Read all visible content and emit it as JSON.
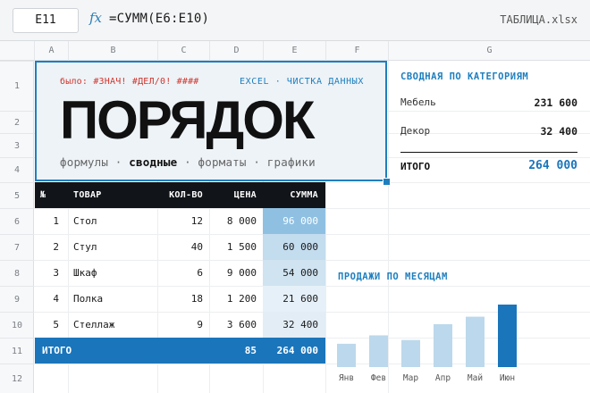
{
  "formula_bar": {
    "cell_ref": "E11",
    "fx_label": "fx",
    "formula": "=СУММ(E6:E10)",
    "file_name": "ТАБЛИЦА.xlsx"
  },
  "columns": [
    "A",
    "B",
    "C",
    "D",
    "E",
    "F",
    "G"
  ],
  "rows": [
    "1",
    "2",
    "3",
    "4",
    "5",
    "6",
    "7",
    "8",
    "9",
    "10",
    "11",
    "12"
  ],
  "hero": {
    "errors": "было: #ЗНАЧ! #ДЕЛ/0! ####",
    "tagline": "EXCEL · ЧИСТКА ДАННЫХ",
    "title": "ПОРЯДОК",
    "sub_1": "формулы · ",
    "sub_bold": "сводные",
    "sub_2": " · форматы · графики"
  },
  "table": {
    "headers": [
      "№",
      "ТОВАР",
      "КОЛ-ВО",
      "ЦЕНА",
      "СУММА"
    ],
    "rows": [
      {
        "n": "1",
        "item": "Стол",
        "qty": "12",
        "price": "8 000",
        "sum": "96 000",
        "shade": 0.9
      },
      {
        "n": "2",
        "item": "Стул",
        "qty": "40",
        "price": "1 500",
        "sum": "60 000",
        "shade": 0.55
      },
      {
        "n": "3",
        "item": "Шкаф",
        "qty": "6",
        "price": "9 000",
        "sum": "54 000",
        "shade": 0.45
      },
      {
        "n": "4",
        "item": "Полка",
        "qty": "18",
        "price": "1 200",
        "sum": "21 600",
        "shade": 0.25
      },
      {
        "n": "5",
        "item": "Стеллаж",
        "qty": "9",
        "price": "3 600",
        "sum": "32 400",
        "shade": 0.3
      }
    ],
    "total": {
      "label": "ИТОГО",
      "qty": "85",
      "sum": "264 000"
    }
  },
  "pivot": {
    "title": "СВОДНАЯ ПО КАТЕГОРИЯМ",
    "rows": [
      {
        "label": "Мебель",
        "value": "231 600"
      },
      {
        "label": "Декор",
        "value": "32 400"
      }
    ],
    "total_label": "ИТОГО",
    "total_value": "264 000"
  },
  "chart_data": {
    "type": "bar",
    "title": "ПРОДАЖИ ПО МЕСЯЦАМ",
    "categories": [
      "Янв",
      "Фев",
      "Мар",
      "Апр",
      "Май",
      "Июн"
    ],
    "values": [
      25,
      34,
      29,
      46,
      54,
      67
    ],
    "highlight": "Июн",
    "colors": {
      "bar": "#bcd8ec",
      "highlight": "#1a75bb"
    },
    "grid": false
  },
  "colors": {
    "accent": "#1e7fbf",
    "total_bar": "#1a75bb",
    "error": "#d0362e",
    "header_dark": "#111418"
  }
}
